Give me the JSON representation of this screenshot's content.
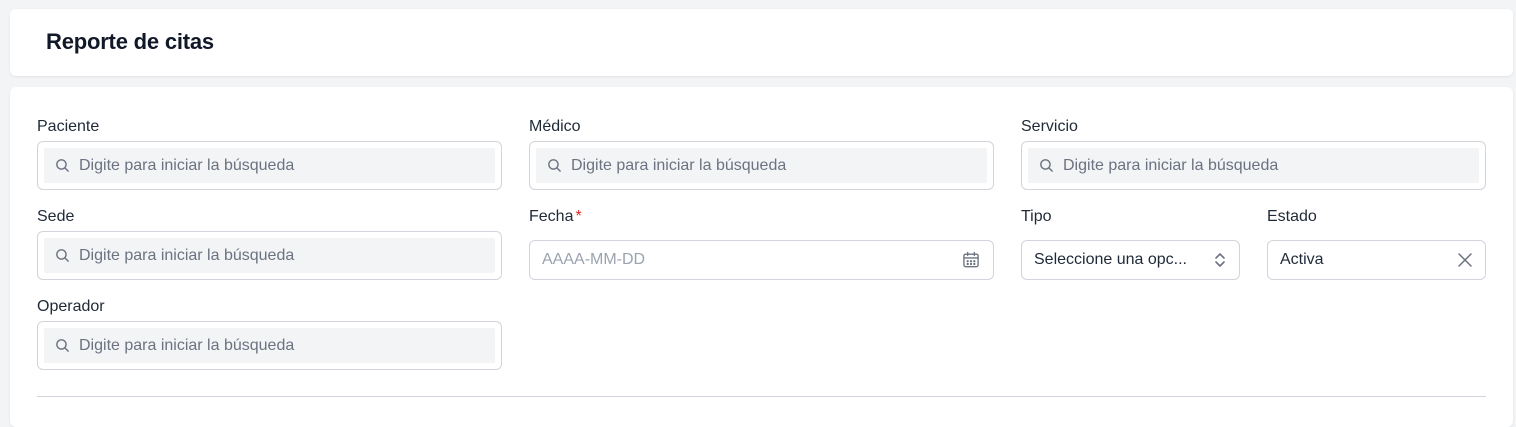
{
  "header": {
    "title": "Reporte de citas"
  },
  "fields": {
    "paciente": {
      "label": "Paciente",
      "placeholder": "Digite para iniciar la búsqueda"
    },
    "medico": {
      "label": "Médico",
      "placeholder": "Digite para iniciar la búsqueda"
    },
    "servicio": {
      "label": "Servicio",
      "placeholder": "Digite para iniciar la búsqueda"
    },
    "sede": {
      "label": "Sede",
      "placeholder": "Digite para iniciar la búsqueda"
    },
    "fecha": {
      "label": "Fecha",
      "required_mark": "*",
      "placeholder": "AAAA-MM-DD"
    },
    "tipo": {
      "label": "Tipo",
      "value": "Seleccione una opc..."
    },
    "estado": {
      "label": "Estado",
      "value": "Activa"
    },
    "operador": {
      "label": "Operador",
      "placeholder": "Digite para iniciar la búsqueda"
    }
  },
  "icons": {
    "search": "search-icon",
    "calendar": "calendar-icon",
    "select": "chevron-up-down-icon",
    "clear": "close-icon"
  },
  "colors": {
    "required": "#dc2626",
    "input_fill": "#f3f4f6",
    "border": "#d1d5db"
  }
}
